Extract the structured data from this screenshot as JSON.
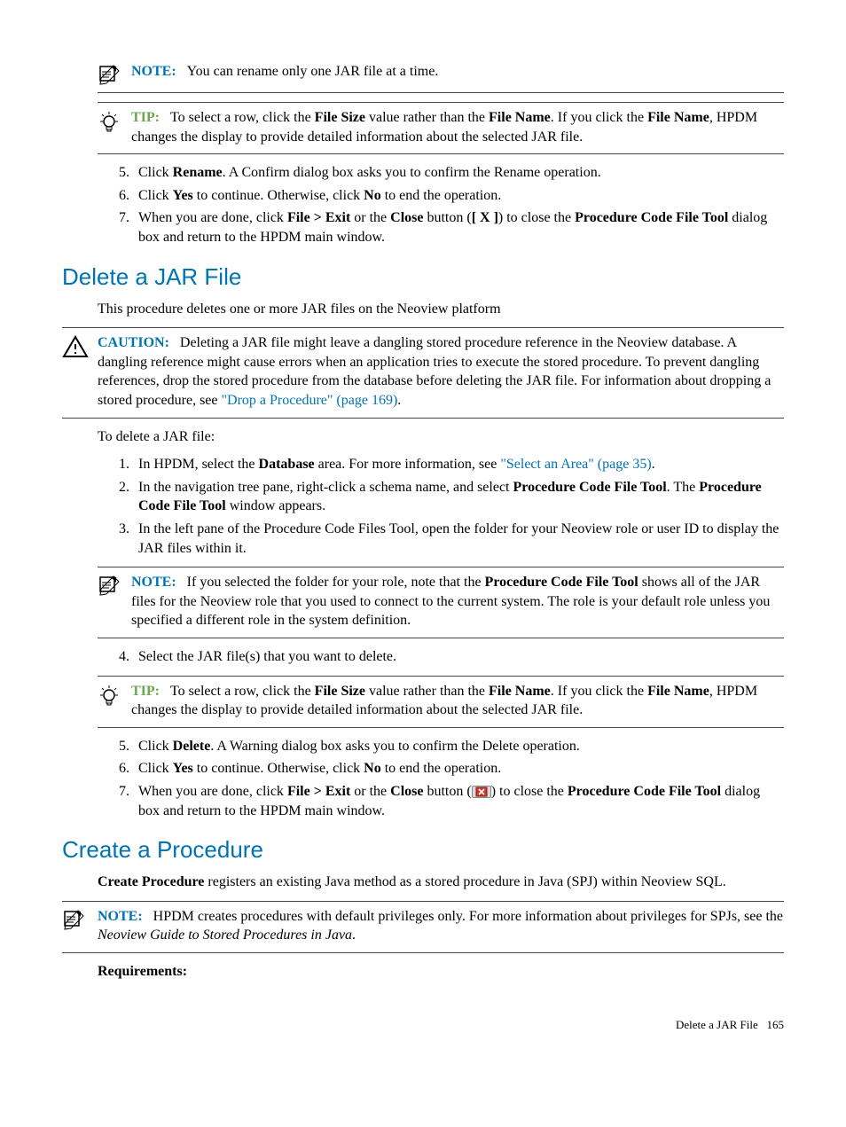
{
  "note1": {
    "label": "NOTE:",
    "text": "You can rename only one JAR file at a time."
  },
  "tip1": {
    "label": "TIP:",
    "t1": "To select a row, click the ",
    "b1": "File Size",
    "t2": " value rather than the ",
    "b2": "File Name",
    "t3": ". If you click the ",
    "b3": "File Name",
    "t4": ", HPDM changes the display to provide detailed information about the selected JAR file."
  },
  "stepsA": {
    "s5": {
      "t1": "Click ",
      "b1": "Rename",
      "t2": ". A Confirm dialog box asks you to confirm the Rename operation."
    },
    "s6": {
      "t1": "Click ",
      "b1": "Yes",
      "t2": " to continue. Otherwise, click ",
      "b2": "No",
      "t3": " to end the operation."
    },
    "s7": {
      "t1": "When you are done, click ",
      "b1": "File > Exit",
      "t2": " or the ",
      "b2": "Close",
      "t3": " button (",
      "b3": "[ X ]",
      "t4": ") to close the ",
      "b4": "Procedure Code File Tool",
      "t5": " dialog box and return to the HPDM main window."
    }
  },
  "section1": {
    "title": "Delete a JAR File",
    "intro": "This procedure deletes one or more JAR files on the Neoview platform"
  },
  "caution1": {
    "label": "CAUTION:",
    "t1": "Deleting a JAR file might leave a dangling stored procedure reference in the Neoview database. A dangling reference might cause errors when an application tries to execute the stored procedure. To prevent dangling references, drop the stored procedure from the database before deleting the JAR file. For information about dropping a stored procedure, see ",
    "link": "\"Drop a Procedure\" (page 169)",
    "t2": "."
  },
  "deleteIntro": "To delete a JAR file:",
  "stepsB": {
    "s1": {
      "t1": "In HPDM, select the ",
      "b1": "Database",
      "t2": " area. For more information, see ",
      "link": "\"Select an Area\" (page 35)",
      "t3": "."
    },
    "s2": {
      "t1": "In the navigation tree pane, right-click a schema name, and select ",
      "b1": "Procedure Code File Tool",
      "t2": ". The ",
      "b2": "Procedure Code File Tool",
      "t3": " window appears."
    },
    "s3": {
      "t1": "In the left pane of the Procedure Code Files Tool, open the folder for your Neoview role or user ID to display the JAR files within it."
    }
  },
  "note2": {
    "label": "NOTE:",
    "t1": "If you selected the folder for your role, note that the ",
    "b1": "Procedure Code File Tool",
    "t2": " shows all of the JAR files for the Neoview role that you used to connect to the current system. The role is your default role unless you specified a different role in the system definition."
  },
  "stepsC": {
    "s4": {
      "t1": "Select the JAR file(s) that you want to delete."
    }
  },
  "tip2": {
    "label": "TIP:",
    "t1": "To select a row, click the ",
    "b1": "File Size",
    "t2": " value rather than the ",
    "b2": "File Name",
    "t3": ". If you click the ",
    "b3": "File Name",
    "t4": ", HPDM changes the display to provide detailed information about the selected JAR file."
  },
  "stepsD": {
    "s5": {
      "t1": "Click ",
      "b1": "Delete",
      "t2": ". A Warning dialog box asks you to confirm the Delete operation."
    },
    "s6": {
      "t1": "Click ",
      "b1": "Yes",
      "t2": " to continue. Otherwise, click ",
      "b2": "No",
      "t3": " to end the operation."
    },
    "s7": {
      "t1": "When you are done, click ",
      "b1": "File > Exit",
      "t2": " or the ",
      "b2": "Close",
      "t3": " button (",
      "t4": ") to close the ",
      "b3": "Procedure Code File Tool",
      "t5": " dialog box and return to the HPDM main window."
    }
  },
  "section2": {
    "title": "Create a Procedure",
    "p1a": "Create Procedure",
    "p1b": " registers an existing Java method as a stored procedure in Java (SPJ) within Neoview SQL."
  },
  "note3": {
    "label": "NOTE:",
    "t1": "HPDM creates procedures with default privileges only. For more information about privileges for SPJs, see the ",
    "i1": "Neoview Guide to Stored Procedures in Java",
    "t2": "."
  },
  "req": "Requirements:",
  "footer": {
    "title": "Delete a JAR File",
    "page": "165"
  }
}
